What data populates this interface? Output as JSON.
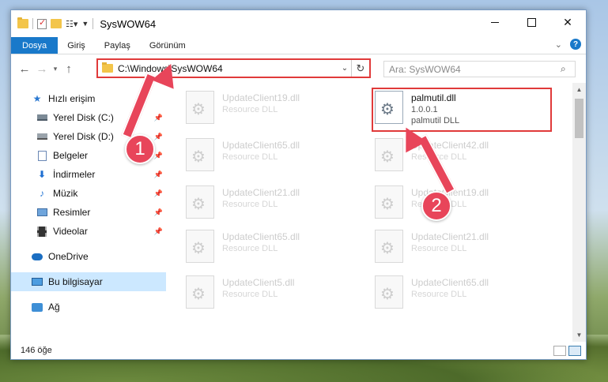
{
  "window": {
    "title": "SysWOW64"
  },
  "ribbon": {
    "tabs": [
      "Dosya",
      "Giriş",
      "Paylaş",
      "Görünüm"
    ]
  },
  "address": {
    "path": "C:\\Windows\\SysWOW64"
  },
  "search": {
    "placeholder": "Ara: SysWOW64"
  },
  "sidebar": {
    "quick_access": "Hızlı erişim",
    "items": [
      {
        "label": "Yerel Disk (C:)",
        "icon": "drive-icon",
        "pinned": true
      },
      {
        "label": "Yerel Disk (D:)",
        "icon": "drive-icon",
        "pinned": true
      },
      {
        "label": "Belgeler",
        "icon": "documents-icon",
        "pinned": true
      },
      {
        "label": "İndirmeler",
        "icon": "downloads-icon",
        "pinned": true
      },
      {
        "label": "Müzik",
        "icon": "music-icon",
        "pinned": true
      },
      {
        "label": "Resimler",
        "icon": "pictures-icon",
        "pinned": true
      },
      {
        "label": "Videolar",
        "icon": "videos-icon",
        "pinned": true
      }
    ],
    "onedrive": "OneDrive",
    "this_pc": "Bu bilgisayar",
    "network": "Ağ"
  },
  "files": {
    "left": [
      {
        "name": "UpdateClient19.dll",
        "type": "Resource DLL"
      },
      {
        "name": "UpdateClient65.dll",
        "type": "Resource DLL"
      },
      {
        "name": "UpdateClient21.dll",
        "type": "Resource DLL"
      },
      {
        "name": "UpdateClient65.dll",
        "type": "Resource DLL"
      },
      {
        "name": "UpdateClient5.dll",
        "type": "Resource DLL"
      }
    ],
    "highlighted": {
      "name": "palmutil.dll",
      "version": "1.0.0.1",
      "type": "palmutil DLL"
    },
    "right": [
      {
        "name": "UpdateClient42.dll",
        "type": "Resource DLL"
      },
      {
        "name": "UpdateClient19.dll",
        "type": "Resource DLL"
      },
      {
        "name": "UpdateClient21.dll",
        "type": "Resource DLL"
      },
      {
        "name": "UpdateClient65.dll",
        "type": "Resource DLL"
      }
    ]
  },
  "status": {
    "count": "146 öğe"
  },
  "annotations": {
    "step1": "1",
    "step2": "2",
    "color": "#e8455a"
  }
}
